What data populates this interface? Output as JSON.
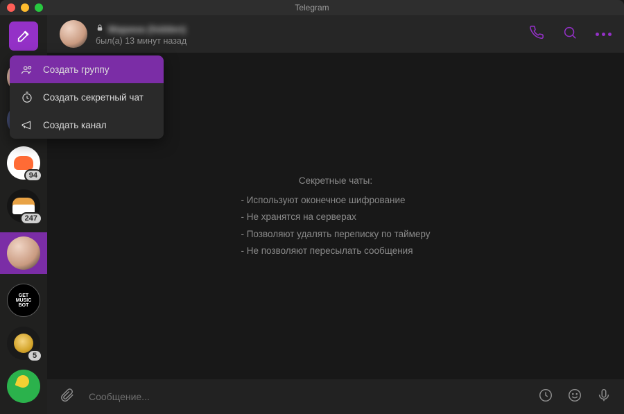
{
  "window": {
    "title": "Telegram"
  },
  "sidebar": {
    "chats": [
      {
        "badge": null
      },
      {
        "badge": null
      },
      {
        "badge": "94"
      },
      {
        "badge": "247"
      },
      {
        "badge": null,
        "selected": true
      },
      {
        "badge": null,
        "label_line1": "GET",
        "label_line2": "MUSIC",
        "label_line3": "BOT"
      },
      {
        "badge": "5"
      },
      {
        "badge": null
      }
    ]
  },
  "header": {
    "name": "Марина (hidden)",
    "status": "был(а) 13 минут назад"
  },
  "secret_chat_info": {
    "title": "Секретные чаты:",
    "bullets": [
      "- Используют оконечное шифрование",
      "- Не хранятся на серверах",
      "- Позволяют удалять переписку по таймеру",
      "- Не позволяют пересылать сообщения"
    ]
  },
  "input": {
    "placeholder": "Сообщение..."
  },
  "menu": {
    "items": [
      {
        "label": "Создать группу",
        "active": true
      },
      {
        "label": "Создать секретный чат",
        "active": false
      },
      {
        "label": "Создать канал",
        "active": false
      }
    ]
  }
}
